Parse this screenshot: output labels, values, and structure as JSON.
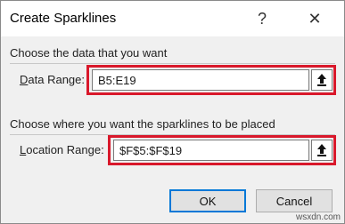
{
  "dialog": {
    "title": "Create Sparklines",
    "help_label": "?",
    "close_label": "✕"
  },
  "data_section": {
    "heading": "Choose the data that you want",
    "field_label_prefix": "",
    "field_label_accel": "D",
    "field_label_rest": "ata Range:",
    "value": "B5:E19"
  },
  "location_section": {
    "heading": "Choose where you want the sparklines to be placed",
    "field_label_accel": "L",
    "field_label_rest": "ocation Range:",
    "value": "$F$5:$F$19"
  },
  "buttons": {
    "ok": "OK",
    "cancel": "Cancel"
  },
  "icons": {
    "collapse": "range-selector-icon",
    "help": "help-icon",
    "close": "close-icon"
  },
  "highlight_color": "#d9182b",
  "watermark": "wsxdn.com"
}
